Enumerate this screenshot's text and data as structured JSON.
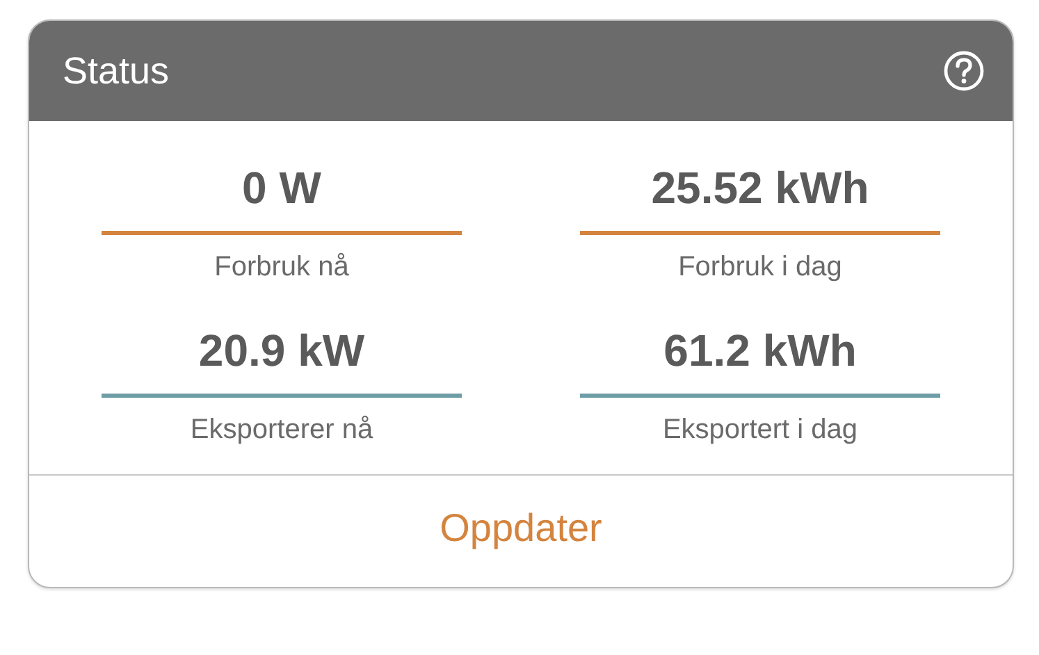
{
  "header": {
    "title": "Status"
  },
  "stats": [
    {
      "value": "0 W",
      "label": "Forbruk nå",
      "color": "#d4843e"
    },
    {
      "value": "25.52 kWh",
      "label": "Forbruk i dag",
      "color": "#d4843e"
    },
    {
      "value": "20.9 kW",
      "label": "Eksporterer nå",
      "color": "#6d9da5"
    },
    {
      "value": "61.2 kWh",
      "label": "Eksportert i dag",
      "color": "#6d9da5"
    }
  ],
  "button": {
    "label": "Oppdater"
  }
}
